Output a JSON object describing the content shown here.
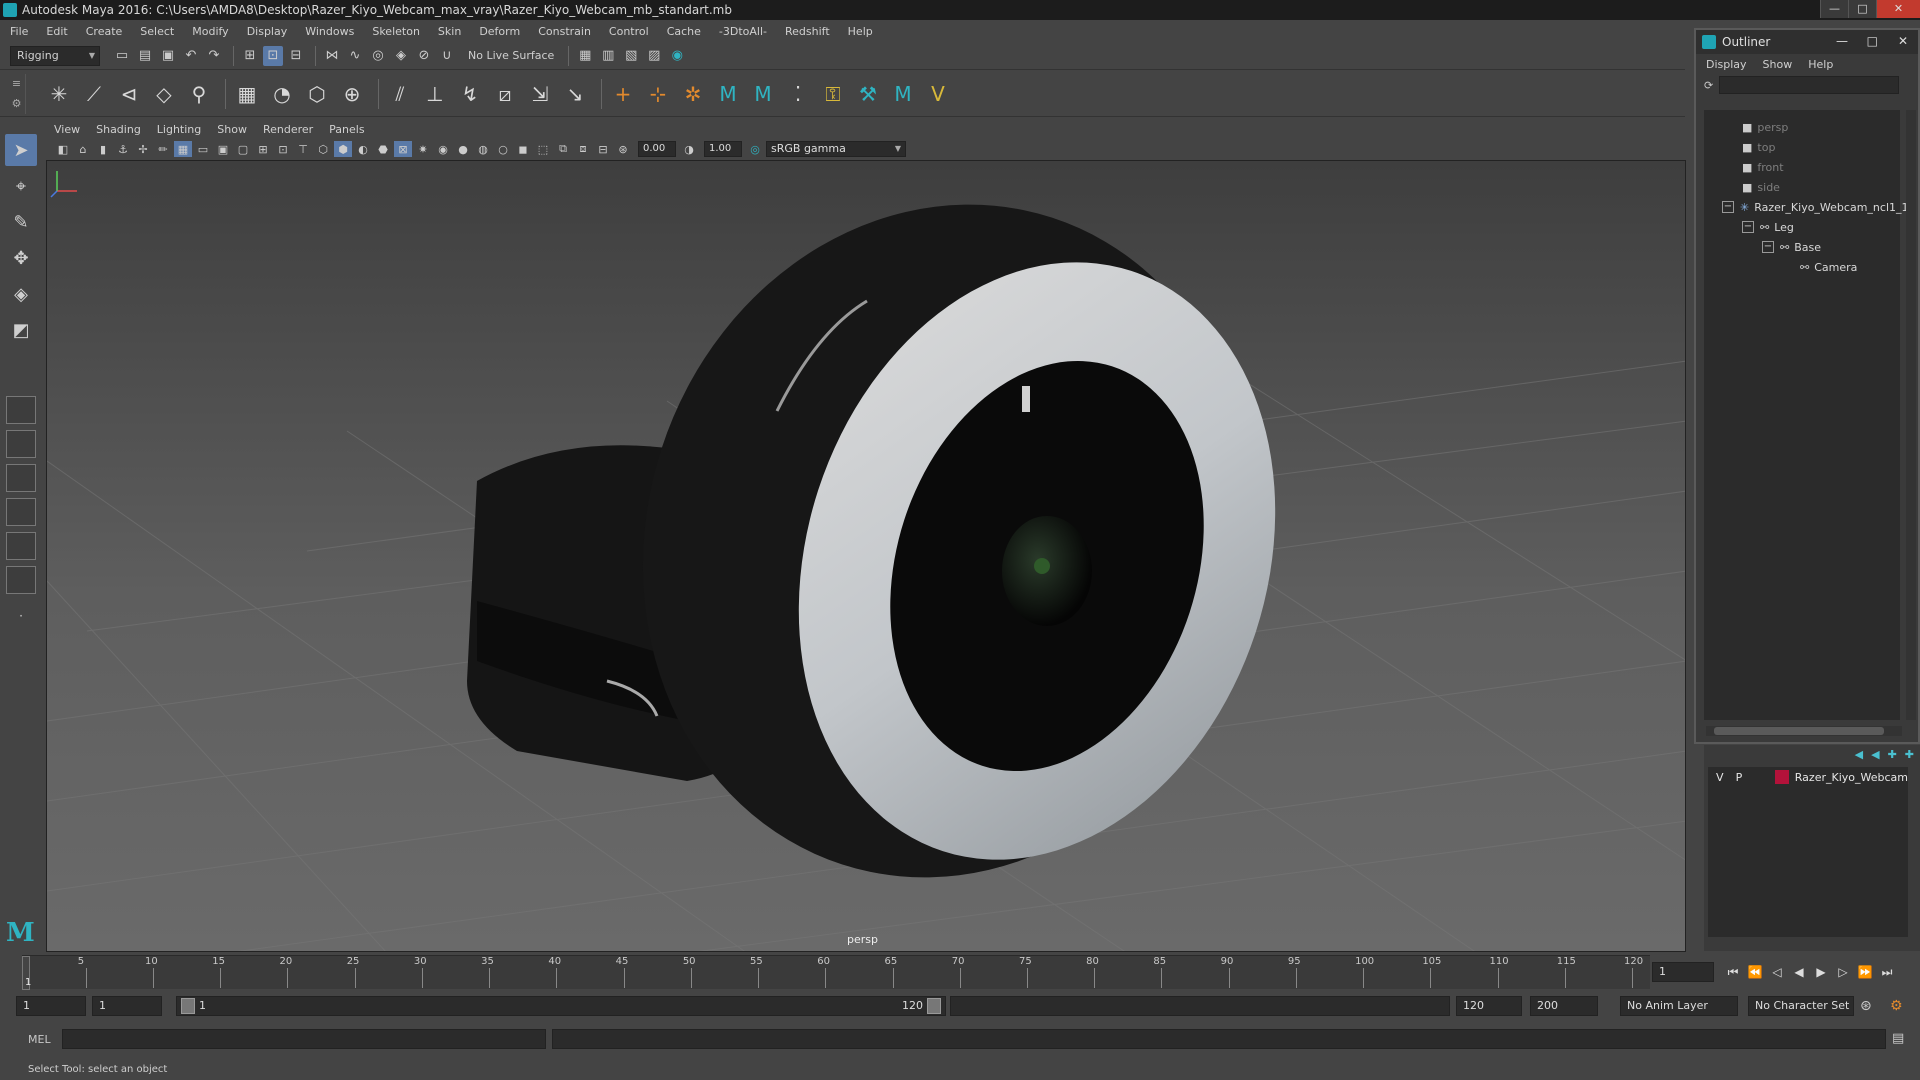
{
  "window": {
    "title": "Autodesk Maya 2016: C:\\Users\\AMDA8\\Desktop\\Razer_Kiyo_Webcam_max_vray\\Razer_Kiyo_Webcam_mb_standart.mb",
    "minimize": "—",
    "maximize": "□",
    "close": "✕"
  },
  "menu": [
    "File",
    "Edit",
    "Create",
    "Select",
    "Modify",
    "Display",
    "Windows",
    "Skeleton",
    "Skin",
    "Deform",
    "Constrain",
    "Control",
    "Cache",
    "-3DtoAll-",
    "Redshift",
    "Help"
  ],
  "status": {
    "menuset": "Rigging",
    "live_surface": "No Live Surface"
  },
  "panel": {
    "menu": [
      "View",
      "Shading",
      "Lighting",
      "Show",
      "Renderer",
      "Panels"
    ],
    "exposure": "0.00",
    "gamma_value": "1.00",
    "color_space": "sRGB gamma",
    "camera_label": "persp"
  },
  "outliner": {
    "title": "Outliner",
    "menu": [
      "Display",
      "Show",
      "Help"
    ],
    "items": [
      {
        "label": "persp",
        "depth": 0,
        "dim": true
      },
      {
        "label": "top",
        "depth": 0,
        "dim": true
      },
      {
        "label": "front",
        "depth": 0,
        "dim": true
      },
      {
        "label": "side",
        "depth": 0,
        "dim": true
      },
      {
        "label": "Razer_Kiyo_Webcam_ncl1_1",
        "depth": 0,
        "dim": false
      },
      {
        "label": "Leg",
        "depth": 1,
        "dim": false
      },
      {
        "label": "Base",
        "depth": 2,
        "dim": false
      },
      {
        "label": "Camera",
        "depth": 3,
        "dim": false
      }
    ]
  },
  "layers": {
    "row": {
      "v": "V",
      "p": "P",
      "name": "Razer_Kiyo_Webcam",
      "color": "#b3123a"
    }
  },
  "timeline": {
    "ticks": [
      "5",
      "10",
      "15",
      "20",
      "25",
      "30",
      "35",
      "40",
      "45",
      "50",
      "55",
      "60",
      "65",
      "70",
      "75",
      "80",
      "85",
      "90",
      "95",
      "100",
      "105",
      "110",
      "115",
      "120"
    ],
    "current_frame": "1",
    "current_field": "1"
  },
  "range": {
    "start": "1",
    "start_inner": "1",
    "range_start": "1",
    "range_end": "120",
    "end_inner": "120",
    "end": "200",
    "anim_layer": "No Anim Layer",
    "char_set": "No Character Set"
  },
  "command": {
    "label": "MEL"
  },
  "help": {
    "text": "Select Tool: select an object"
  }
}
